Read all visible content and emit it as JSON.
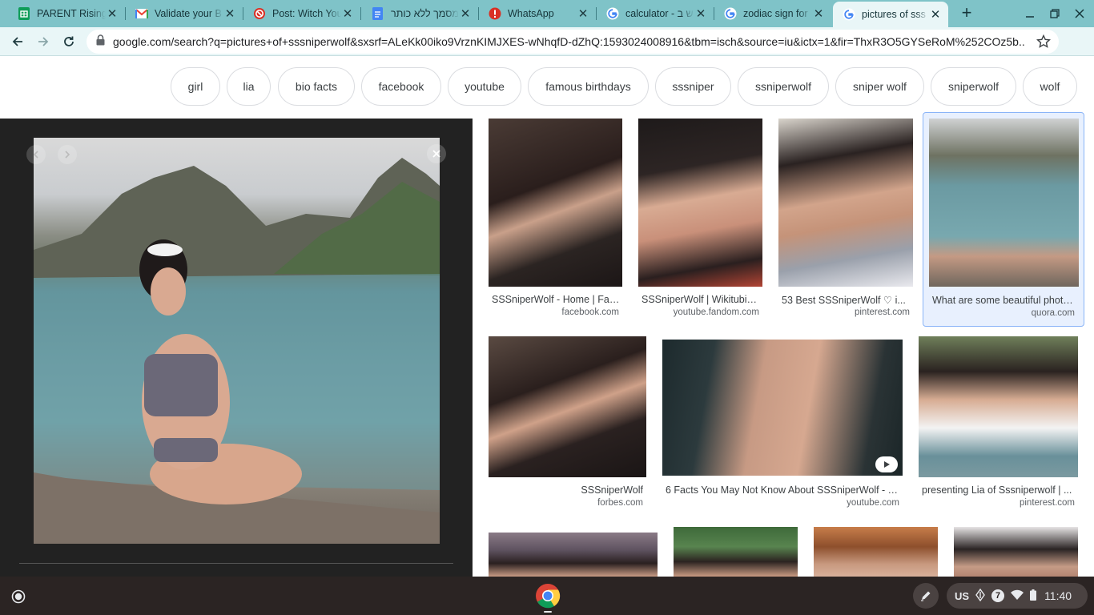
{
  "browser": {
    "tabs": [
      {
        "title": "PARENT Rising",
        "favicon": "sheets-icon",
        "color": "#0f9d58"
      },
      {
        "title": "Validate your B",
        "favicon": "gmail-icon",
        "color": "#ea4335"
      },
      {
        "title": "Post: Witch You",
        "favicon": "blocked-icon",
        "color": "#d93025"
      },
      {
        "title": "מסמך ללא כותר",
        "favicon": "docs-icon",
        "color": "#4285f4"
      },
      {
        "title": "WhatsApp",
        "favicon": "alert-icon",
        "color": "#d93025"
      },
      {
        "title": "calculator - ש ב",
        "favicon": "google-icon",
        "color": "#4285f4"
      },
      {
        "title": "zodiac sign for",
        "favicon": "google-icon",
        "color": "#4285f4"
      },
      {
        "title": "pictures of sss",
        "favicon": "google-icon",
        "color": "#4285f4",
        "active": true
      }
    ],
    "url": "google.com/search?q=pictures+of+sssniperwolf&sxsrf=ALeKk00iko9VrznKIMJXES-wNhqfD-dZhQ:1593024008916&tbm=isch&source=iu&ictx=1&fir=ThxR3O5GYSeRoM%252COz5b..."
  },
  "chips": [
    "girl",
    "lia",
    "bio facts",
    "facebook",
    "youtube",
    "famous birthdays",
    "sssniper",
    "ssniperwolf",
    "sniper wolf",
    "sniperwolf",
    "wolf"
  ],
  "results": [
    {
      "caption": "SSSniperWolf - Home | Fac...",
      "source": "facebook.com"
    },
    {
      "caption": "SSSniperWolf | Wikitubia ...",
      "source": "youtube.fandom.com"
    },
    {
      "caption": "53 Best SSSniperWolf ♡ i...",
      "source": "pinterest.com"
    },
    {
      "caption": "What are some beautiful photo...",
      "source": "quora.com"
    },
    {
      "caption": "SSSniperWolf",
      "source": "forbes.com"
    },
    {
      "caption": "6 Facts You May Not Know About SSSniperWolf - Y...",
      "source": "youtube.com"
    },
    {
      "caption": "presenting Lia of Sssniperwolf | ...",
      "source": "pinterest.com"
    }
  ],
  "shelf": {
    "ime": "US",
    "notification_count": "7",
    "time": "11:40"
  },
  "colors": {
    "tab_strip": "#7fc3c8",
    "toolbar": "#e9f6f7",
    "preview_bg": "#222222",
    "shelf": "#2b2423",
    "selection": "#8ab4f8"
  }
}
